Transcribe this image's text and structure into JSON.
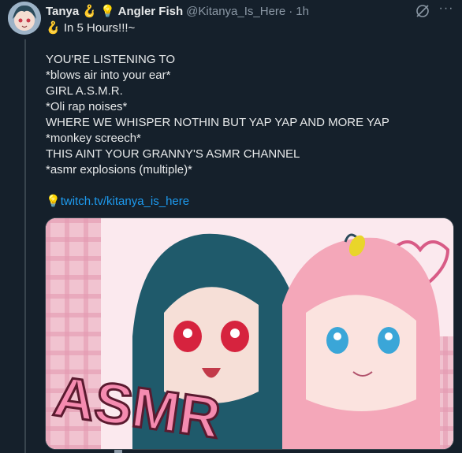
{
  "tweet": {
    "author_name": "Tanya",
    "author_emoji_1": "🪝",
    "author_emoji_2": "💡",
    "author_suffix": "Angler Fish",
    "handle": "@Kitanya_Is_Here",
    "separator": "·",
    "time": "1h",
    "lines": [
      "🪝 In 5 Hours!!!~",
      "",
      " YOU'RE LISTENING TO",
      "*blows air into your ear*",
      "GIRL A.S.M.R.",
      "*Oli rap noises*",
      "WHERE WE WHISPER NOTHIN BUT YAP YAP AND MORE YAP",
      "*monkey screech*",
      "THIS AINT YOUR GRANNY'S ASMR CHANNEL",
      "*asmr explosions (multiple)*",
      ""
    ],
    "link_emoji": "💡",
    "link_text": "twitch.tv/kitanya_is_here",
    "media_text": "ASMR"
  },
  "icons": {
    "grok": "grok-icon",
    "more": "more-icon"
  },
  "colors": {
    "background": "#15202b",
    "text": "#e7e9ea",
    "muted": "#8b98a5",
    "link": "#1d9bf0"
  }
}
